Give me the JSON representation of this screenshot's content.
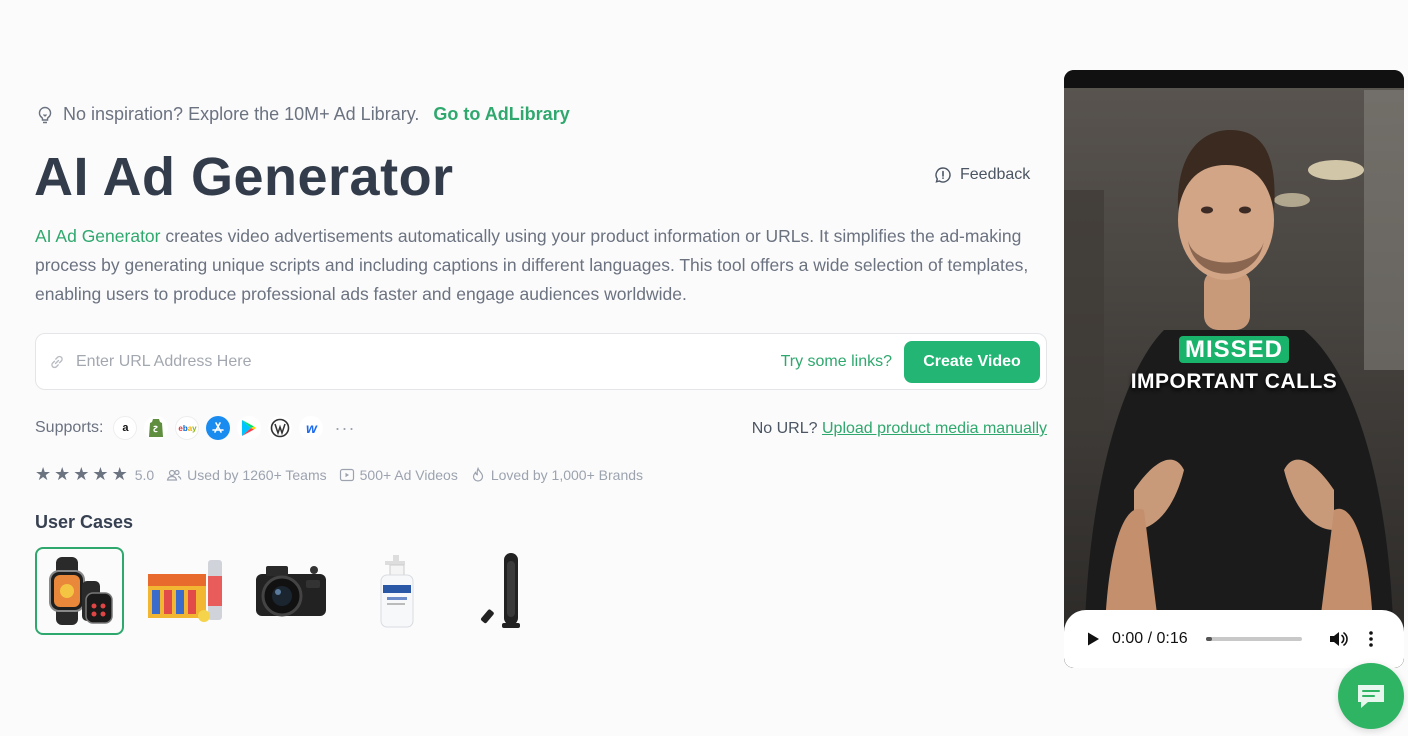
{
  "tip": {
    "text": "No inspiration? Explore the 10M+ Ad Library.",
    "link": "Go to AdLibrary"
  },
  "title": "AI Ad Generator",
  "feedback_label": "Feedback",
  "description": {
    "highlight": "AI Ad Generator",
    "rest": " creates video advertisements automatically using your product information or URLs. It simplifies the ad-making process by generating unique scripts and including captions in different languages. This tool offers a wide selection of templates, enabling users to produce professional ads faster and engage audiences worldwide."
  },
  "url_input": {
    "placeholder": "Enter URL Address Here",
    "try_label": "Try some links?",
    "create_label": "Create Video"
  },
  "supports": {
    "label": "Supports:",
    "platforms": [
      "amazon",
      "shopify",
      "ebay",
      "app-store",
      "google-play",
      "wordpress",
      "wix"
    ],
    "more": "···"
  },
  "no_url": {
    "prefix": "No URL?",
    "link": "Upload product media manually"
  },
  "stats": {
    "stars": 5,
    "rating": "5.0",
    "teams": "Used by 1260+ Teams",
    "videos": "500+ Ad Videos",
    "brands": "Loved by 1,000+ Brands"
  },
  "user_cases": {
    "title": "User Cases",
    "items": [
      "smartwatch",
      "energy-drink-cans",
      "camera",
      "lotion-bottle",
      "tower-fan"
    ],
    "selected": 0
  },
  "video": {
    "caption_highlight": "MISSED",
    "caption_line2": "IMPORTANT CALLS",
    "time": "0:00 / 0:16",
    "progress": 0.0
  },
  "colors": {
    "accent": "#2fa86e",
    "button": "#22b573",
    "chat": "#2fb463"
  }
}
